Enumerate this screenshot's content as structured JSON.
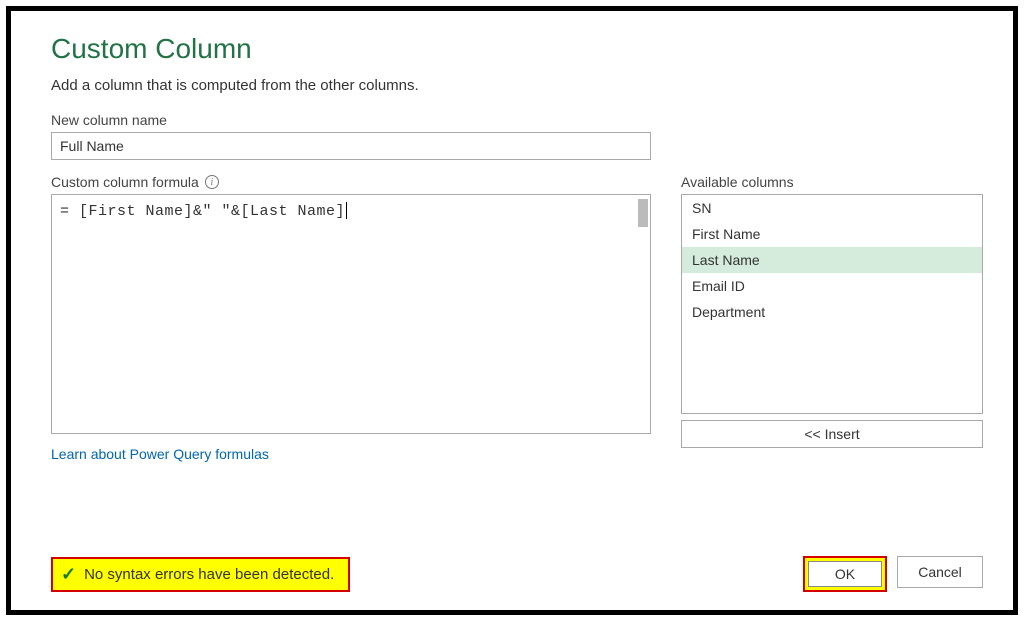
{
  "dialog": {
    "title": "Custom Column",
    "subtitle": "Add a column that is computed from the other columns."
  },
  "newColumn": {
    "label": "New column name",
    "value": "Full Name"
  },
  "formula": {
    "label": "Custom column formula",
    "value": "= [First Name]&\" \"&[Last Name]"
  },
  "availableColumns": {
    "label": "Available columns",
    "items": [
      "SN",
      "First Name",
      "Last Name",
      "Email ID",
      "Department"
    ],
    "selectedIndex": 2,
    "insertLabel": "<< Insert"
  },
  "learnLink": "Learn about Power Query formulas",
  "status": {
    "text": "No syntax errors have been detected."
  },
  "buttons": {
    "ok": "OK",
    "cancel": "Cancel"
  }
}
